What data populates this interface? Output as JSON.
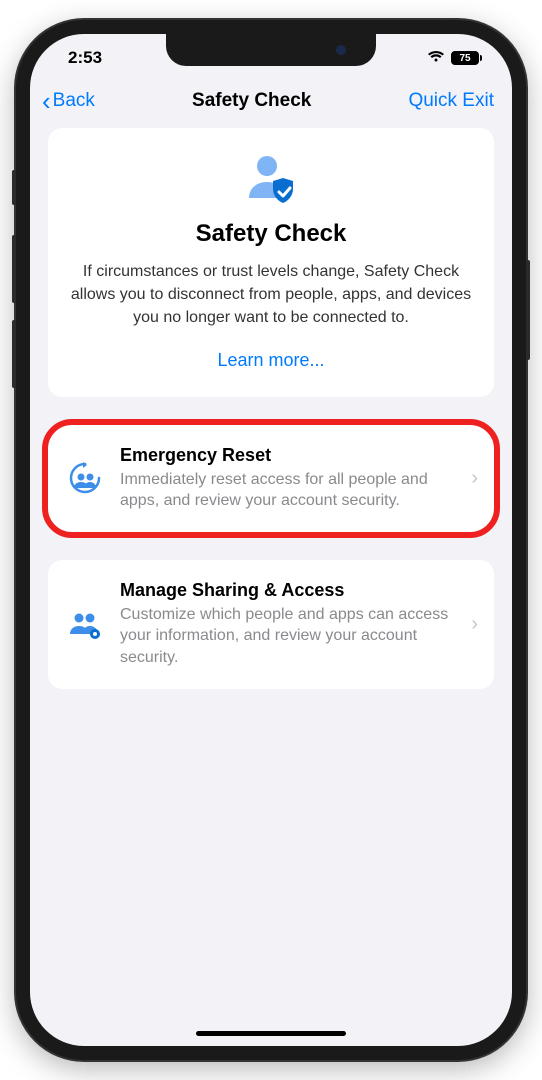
{
  "statusBar": {
    "time": "2:53",
    "battery": "75"
  },
  "nav": {
    "back": "Back",
    "title": "Safety Check",
    "quickExit": "Quick Exit"
  },
  "hero": {
    "title": "Safety Check",
    "description": "If circumstances or trust levels change, Safety Check allows you to disconnect from people, apps, and devices you no longer want to be connected to.",
    "learnMore": "Learn more..."
  },
  "options": {
    "emergency": {
      "title": "Emergency Reset",
      "description": "Immediately reset access for all people and apps, and review your account security."
    },
    "manage": {
      "title": "Manage Sharing & Access",
      "description": "Customize which people and apps can access your information, and review your account security."
    }
  }
}
